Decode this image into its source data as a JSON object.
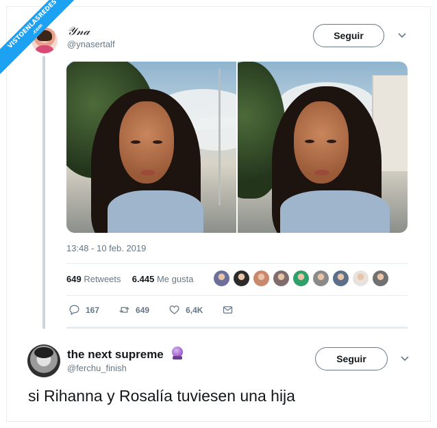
{
  "watermark": {
    "line1": "VISTOENLASREDES",
    "line2": ".com"
  },
  "tweet": {
    "author_name": "𝒴𝓃𝒶",
    "author_handle": "@ynasertalf",
    "follow_label": "Seguir",
    "timestamp": "13:48 - 10 feb. 2019",
    "retweets_count": "649",
    "retweets_label": "Retweets",
    "likes_count": "6.445",
    "likes_label": "Me gusta",
    "actions": {
      "reply": "167",
      "retweet": "649",
      "like": "6,4K"
    },
    "likers_colors": [
      "#6b6f9a",
      "#2b2b2b",
      "#c9876b",
      "#7f6c6c",
      "#2fa06a",
      "#8a8a8a",
      "#5d6f88",
      "#e7e2de",
      "#707070"
    ]
  },
  "reply": {
    "author_name": "the next supreme",
    "author_handle": "@ferchu_finish",
    "follow_label": "Seguir",
    "text": "si Rihanna y Rosalía tuviesen una hija"
  },
  "colors": {
    "accent": "#1da1f2",
    "muted": "#657786",
    "border": "#e6ecf0"
  }
}
